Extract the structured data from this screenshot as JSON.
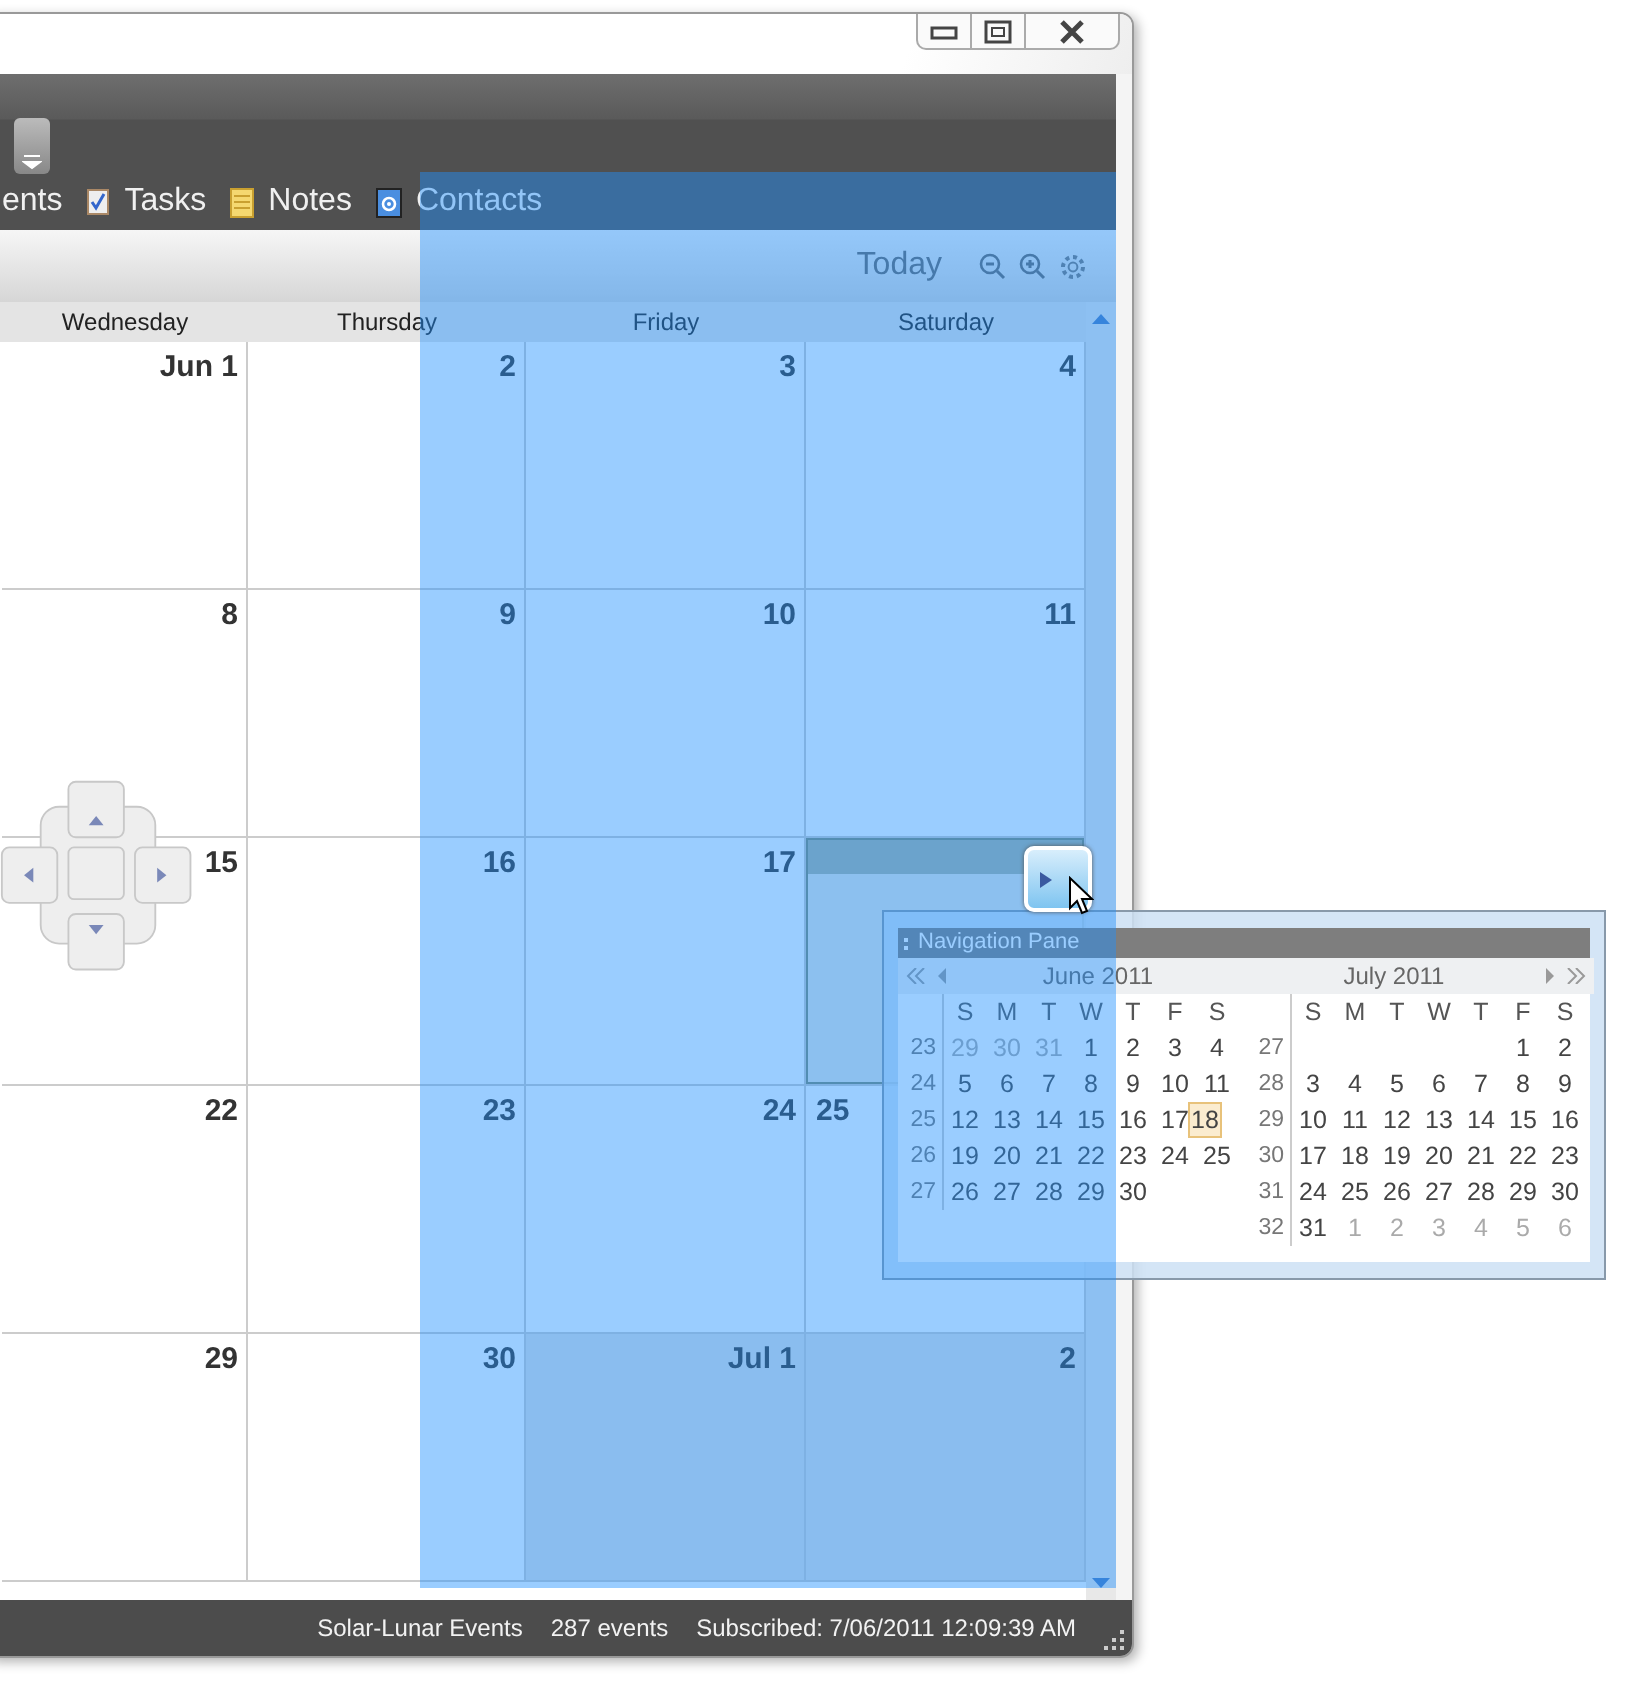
{
  "nav_tabs": [
    {
      "label": "ents",
      "kind": "partial"
    },
    {
      "label": "Tasks",
      "kind": "tasks"
    },
    {
      "label": "Notes",
      "kind": "notes"
    },
    {
      "label": "Contacts",
      "kind": "contacts"
    }
  ],
  "toolbar": {
    "today": "Today"
  },
  "day_headers": [
    "Wednesday",
    "Thursday",
    "Friday",
    "Saturday"
  ],
  "weeks": [
    [
      {
        "day": "Jun 1",
        "other_month": false
      },
      {
        "day": "2",
        "other_month": false
      },
      {
        "day": "3",
        "other_month": false
      },
      {
        "day": "4",
        "other_month": false
      }
    ],
    [
      {
        "day": "8",
        "other_month": false
      },
      {
        "day": "9",
        "other_month": false
      },
      {
        "day": "10",
        "other_month": false
      },
      {
        "day": "11",
        "other_month": false
      }
    ],
    [
      {
        "day": "15",
        "other_month": false
      },
      {
        "day": "16",
        "other_month": false
      },
      {
        "day": "17",
        "other_month": false
      },
      {
        "dock_preview": true,
        "other_month": false
      }
    ],
    [
      {
        "day": "22",
        "other_month": false
      },
      {
        "day": "23",
        "other_month": false
      },
      {
        "day": "24",
        "other_month": false
      },
      {
        "day": "25",
        "other_month": false
      }
    ],
    [
      {
        "day": "29",
        "other_month": false
      },
      {
        "day": "30",
        "other_month": false
      },
      {
        "day": "Jul 1",
        "other_month": true
      },
      {
        "day": "2",
        "other_month": true
      }
    ]
  ],
  "status_bar": [
    "Solar-Lunar Events",
    "287 events",
    "Subscribed: 7/06/2011 12:09:39 AM"
  ],
  "navigation_pane": {
    "title": "Navigation Pane",
    "months": [
      {
        "title": "June 2011",
        "weekdays": [
          "S",
          "M",
          "T",
          "W",
          "T",
          "F",
          "S"
        ],
        "weeks": [
          {
            "week": "23",
            "days": [
              {
                "d": "29",
                "dim": true
              },
              {
                "d": "30",
                "dim": true
              },
              {
                "d": "31",
                "dim": true
              },
              {
                "d": "1",
                "dim": false
              },
              {
                "d": "2",
                "dim": false
              },
              {
                "d": "3",
                "dim": false
              },
              {
                "d": "4",
                "dim": false
              }
            ]
          },
          {
            "week": "24",
            "days": [
              {
                "d": "5",
                "dim": false
              },
              {
                "d": "6",
                "dim": false
              },
              {
                "d": "7",
                "dim": false
              },
              {
                "d": "8",
                "dim": false
              },
              {
                "d": "9",
                "dim": false
              },
              {
                "d": "10",
                "dim": false
              },
              {
                "d": "11",
                "dim": false
              }
            ]
          },
          {
            "week": "25",
            "days": [
              {
                "d": "12",
                "dim": false
              },
              {
                "d": "13",
                "dim": false
              },
              {
                "d": "14",
                "dim": false
              },
              {
                "d": "15",
                "dim": false
              },
              {
                "d": "16",
                "dim": false
              },
              {
                "d": "17",
                "dim": false
              },
              {
                "d": "18",
                "dim": false,
                "today": true
              }
            ]
          },
          {
            "week": "26",
            "days": [
              {
                "d": "19",
                "dim": false
              },
              {
                "d": "20",
                "dim": false
              },
              {
                "d": "21",
                "dim": false
              },
              {
                "d": "22",
                "dim": false
              },
              {
                "d": "23",
                "dim": false
              },
              {
                "d": "24",
                "dim": false
              },
              {
                "d": "25",
                "dim": false
              }
            ]
          },
          {
            "week": "27",
            "days": [
              {
                "d": "26",
                "dim": false
              },
              {
                "d": "27",
                "dim": false
              },
              {
                "d": "28",
                "dim": false
              },
              {
                "d": "29",
                "dim": false
              },
              {
                "d": "30",
                "dim": false
              }
            ]
          }
        ]
      },
      {
        "title": "July 2011",
        "weekdays": [
          "S",
          "M",
          "T",
          "W",
          "T",
          "F",
          "S"
        ],
        "weeks": [
          {
            "week": "27",
            "days": [
              {
                "d": "1",
                "dim": false
              },
              {
                "d": "2",
                "dim": false
              }
            ]
          },
          {
            "week": "28",
            "days": [
              {
                "d": "3",
                "dim": false
              },
              {
                "d": "4",
                "dim": false
              },
              {
                "d": "5",
                "dim": false
              },
              {
                "d": "6",
                "dim": false
              },
              {
                "d": "7",
                "dim": false
              },
              {
                "d": "8",
                "dim": false
              },
              {
                "d": "9",
                "dim": false
              }
            ]
          },
          {
            "week": "29",
            "days": [
              {
                "d": "10",
                "dim": false
              },
              {
                "d": "11",
                "dim": false
              },
              {
                "d": "12",
                "dim": false
              },
              {
                "d": "13",
                "dim": false
              },
              {
                "d": "14",
                "dim": false
              },
              {
                "d": "15",
                "dim": false
              },
              {
                "d": "16",
                "dim": false
              }
            ]
          },
          {
            "week": "30",
            "days": [
              {
                "d": "17",
                "dim": false
              },
              {
                "d": "18",
                "dim": false
              },
              {
                "d": "19",
                "dim": false
              },
              {
                "d": "20",
                "dim": false
              },
              {
                "d": "21",
                "dim": false
              },
              {
                "d": "22",
                "dim": false
              },
              {
                "d": "23",
                "dim": false
              }
            ]
          },
          {
            "week": "31",
            "days": [
              {
                "d": "24",
                "dim": false
              },
              {
                "d": "25",
                "dim": false
              },
              {
                "d": "26",
                "dim": false
              },
              {
                "d": "27",
                "dim": false
              },
              {
                "d": "28",
                "dim": false
              },
              {
                "d": "29",
                "dim": false
              },
              {
                "d": "30",
                "dim": false
              }
            ]
          },
          {
            "week": "32",
            "days": [
              {
                "d": "31",
                "dim": false
              },
              {
                "d": "1",
                "dim": true
              },
              {
                "d": "2",
                "dim": true
              },
              {
                "d": "3",
                "dim": true
              },
              {
                "d": "4",
                "dim": true
              },
              {
                "d": "5",
                "dim": true
              },
              {
                "d": "6",
                "dim": true
              }
            ]
          }
        ]
      }
    ]
  }
}
